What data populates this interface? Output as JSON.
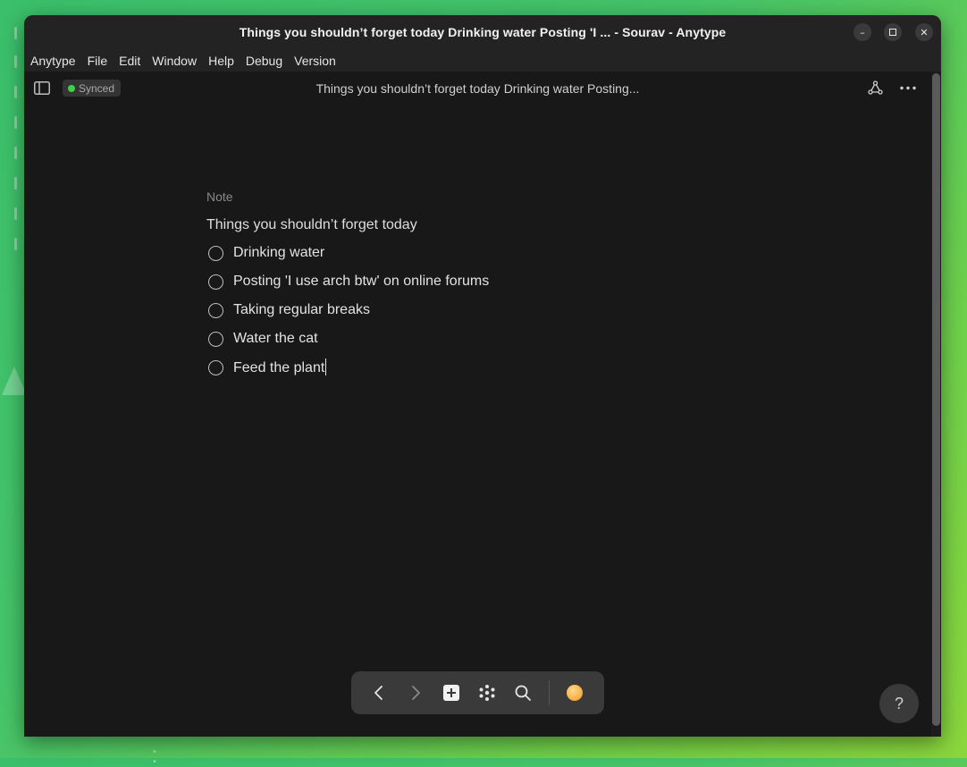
{
  "window": {
    "title": "Things you shouldn’t forget today Drinking water Posting 'I ... - Sourav - Anytype",
    "controls": [
      "minimize-icon",
      "maximize-icon",
      "close-icon"
    ]
  },
  "menu": {
    "items": [
      "Anytype",
      "File",
      "Edit",
      "Window",
      "Help",
      "Debug",
      "Version"
    ]
  },
  "header": {
    "sync_status": "Synced",
    "sync_color": "#3ecf4c",
    "page_title": "Things you shouldn’t forget today Drinking water Posting..."
  },
  "note": {
    "type_label": "Note",
    "title": "Things you shouldn’t forget today",
    "tasks": [
      {
        "text": "Drinking water",
        "done": false
      },
      {
        "text": "Posting 'I use arch btw' on online forums",
        "done": false
      },
      {
        "text": "Taking regular breaks",
        "done": false
      },
      {
        "text": "Water the cat",
        "done": false
      },
      {
        "text": "Feed the plant",
        "done": false
      }
    ]
  },
  "navbar": {
    "icons": [
      "back-arrow-icon",
      "forward-arrow-icon",
      "plus-icon",
      "graph-dots-icon",
      "search-icon",
      "avatar"
    ]
  },
  "help": {
    "label": "?"
  },
  "colors": {
    "window_bg": "#181818",
    "titlebar_bg": "#232323",
    "navbar_bg": "#3a3a3a"
  }
}
